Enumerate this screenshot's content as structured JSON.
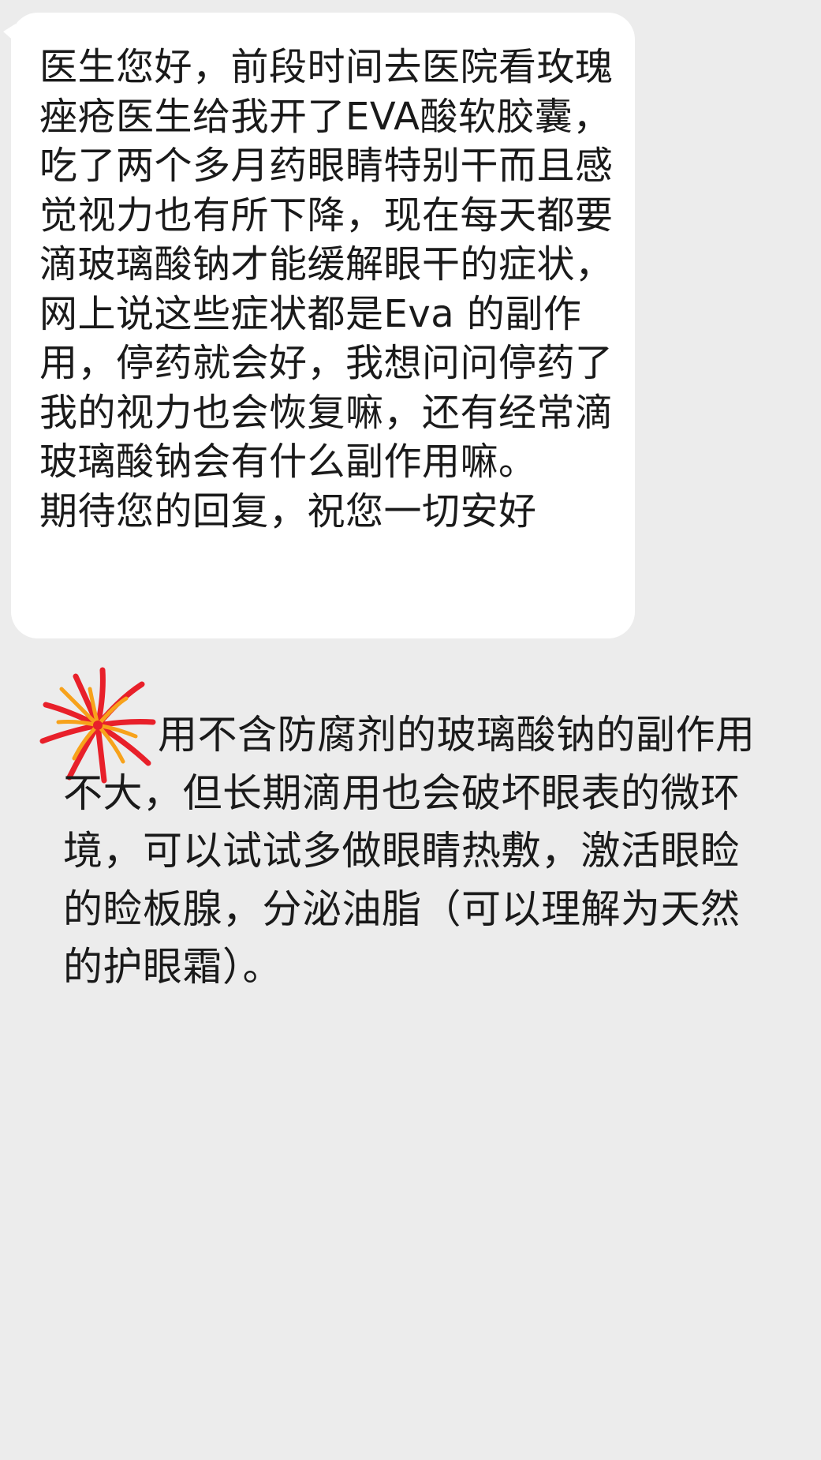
{
  "question": {
    "paragraphs": [
      "医生您好，前段时间去医院看玫瑰痤疮医生给我开了EVA酸软胶囊，吃了两个多月药眼睛特别干而且感觉视力也有所下降，现在每天都要滴玻璃酸钠才能缓解眼干的症状，网上说这些症状都是Eva 的副作用，停药就会好，我想问问停药了我的视力也会恢复嘛，还有经常滴玻璃酸钠会有什么副作用嘛。",
      "期待您的回复，祝您一切安好"
    ]
  },
  "reply": {
    "icon": "firework-icon",
    "text": "用不含防腐剂的玻璃酸钠的副作用不大，但长期滴用也会破坏眼表的微环境，可以试试多做眼睛热敷，激活眼睑的睑板腺，分泌油脂（可以理解为天然的护眼霜）。"
  },
  "colors": {
    "background": "#ececec",
    "bubble": "#ffffff",
    "text": "#1a1a1a",
    "firework_primary": "#e8202a",
    "firework_secondary": "#f7a21b"
  }
}
